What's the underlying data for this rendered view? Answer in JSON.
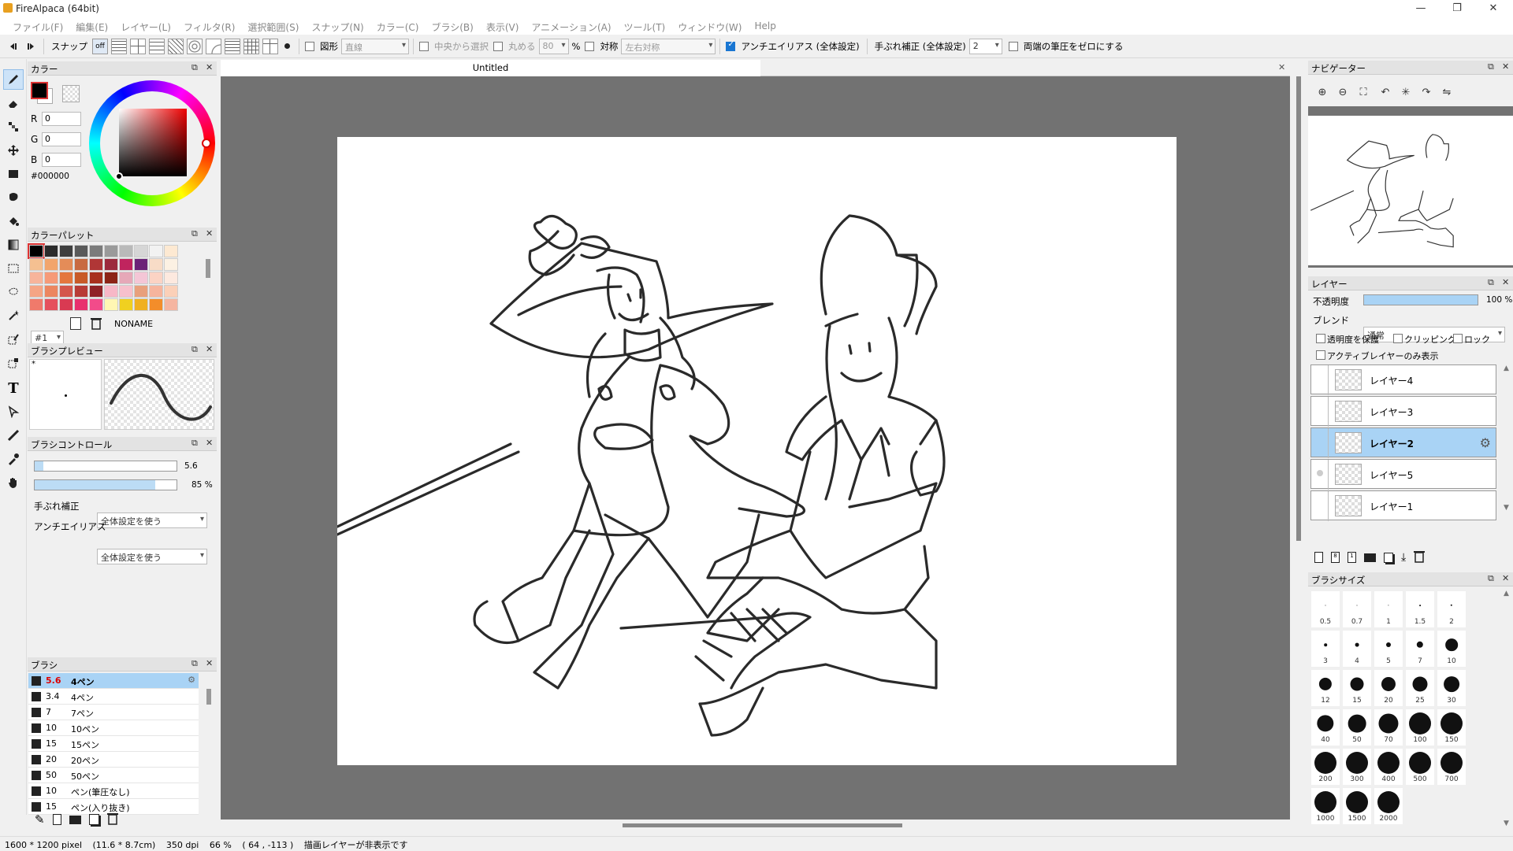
{
  "window": {
    "title": "FireAlpaca (64bit)",
    "controls": [
      "—",
      "❐",
      "✕"
    ]
  },
  "menu": [
    "ファイル(F)",
    "編集(E)",
    "レイヤー(L)",
    "フィルタ(R)",
    "選択範囲(S)",
    "スナップ(N)",
    "カラー(C)",
    "ブラシ(B)",
    "表示(V)",
    "アニメーション(A)",
    "ツール(T)",
    "ウィンドウ(W)",
    "Help"
  ],
  "toolbar": {
    "snap_label": "スナップ",
    "snap_off": "off",
    "shape_label": "図形",
    "shape_value": "直線",
    "center_label": "中央から選択",
    "round_label": "丸める",
    "round_value": "80",
    "percent": "%",
    "symmetry_label": "対称",
    "symmetry_value": "左右対称",
    "antialias_label": "アンチエイリアス (全体設定)",
    "stabilizer_label": "手ぶれ補正 (全体設定)",
    "stabilizer_value": "2",
    "zero_pressure_label": "両端の筆圧をゼロにする"
  },
  "color_panel": {
    "title": "カラー",
    "r_label": "R",
    "r": "0",
    "g_label": "G",
    "g": "0",
    "b_label": "B",
    "b": "0",
    "hex": "#000000",
    "fg_color": "#000000"
  },
  "palette_panel": {
    "title": "カラーパレット",
    "index": "#1",
    "name": "NONAME",
    "colors": [
      "#000000",
      "#2b2b2b",
      "#3f3f3f",
      "#5a5a5a",
      "#7b7b7b",
      "#9a9a9a",
      "#b9b9b9",
      "#d6d6d6",
      "#f2f2f2",
      "#fde9d2",
      "#f5c091",
      "#f2a56b",
      "#e48c58",
      "#c86a41",
      "#b03636",
      "#9c2a3d",
      "#c0245e",
      "#6b2277",
      "#f8dcc7",
      "#fcf1e3",
      "#f7b49b",
      "#f69a78",
      "#e4773e",
      "#c85a28",
      "#a8301d",
      "#8c2416",
      "#e6a8b8",
      "#f4c6d6",
      "#fbd3c4",
      "#fde9df",
      "#f5a585",
      "#ec8660",
      "#d4564b",
      "#b83b36",
      "#8f2226",
      "#f7b8c7",
      "#f7c0cc",
      "#e8a07c",
      "#f6b49d",
      "#fbd0b8",
      "#f07a6b",
      "#e5505d",
      "#d93a52",
      "#e8306e",
      "#f24b8a",
      "#fff7b3",
      "#f0d020",
      "#f0b020",
      "#f38d2a",
      "#f5b5a0"
    ]
  },
  "brush_preview": {
    "title": "ブラシプレビュー",
    "asterisk": "*"
  },
  "brush_control": {
    "title": "ブラシコントロール",
    "size": "5.6",
    "size_fraction": 0.06,
    "opacity": "85 %",
    "opacity_fraction": 0.85,
    "stabilizer_label": "手ぶれ補正",
    "stabilizer_value": "全体設定を使う",
    "antialias_label": "アンチエイリアス",
    "antialias_value": "全体設定を使う"
  },
  "brush_panel": {
    "title": "ブラシ",
    "items": [
      {
        "size": "5.6",
        "name": "4ペン"
      },
      {
        "size": "3.4",
        "name": "4ペン"
      },
      {
        "size": "7",
        "name": "7ペン"
      },
      {
        "size": "10",
        "name": "10ペン"
      },
      {
        "size": "15",
        "name": "15ペン"
      },
      {
        "size": "20",
        "name": "20ペン"
      },
      {
        "size": "50",
        "name": "50ペン"
      },
      {
        "size": "10",
        "name": "ペン(筆圧なし)"
      },
      {
        "size": "15",
        "name": "ペン(入り抜き)"
      }
    ]
  },
  "canvas": {
    "tab": "Untitled"
  },
  "navigator": {
    "title": "ナビゲーター"
  },
  "layers_panel": {
    "title": "レイヤー",
    "opacity_label": "不透明度",
    "opacity_value": "100 %",
    "opacity_fraction": 1.0,
    "blend_label": "ブレンド",
    "blend_value": "通常",
    "preserve_alpha": "透明度を保護",
    "clipping": "クリッピング",
    "lock": "ロック",
    "active_only": "アクティブレイヤーのみ表示",
    "layers": [
      {
        "name": "レイヤー4",
        "selected": false
      },
      {
        "name": "レイヤー3",
        "selected": false
      },
      {
        "name": "レイヤー2",
        "selected": true
      },
      {
        "name": "レイヤー5",
        "selected": false
      },
      {
        "name": "レイヤー1",
        "selected": false
      }
    ]
  },
  "brush_size_panel": {
    "title": "ブラシサイズ",
    "sizes": [
      "0.5",
      "0.7",
      "1",
      "1.5",
      "2",
      "3",
      "4",
      "5",
      "7",
      "10",
      "12",
      "15",
      "20",
      "25",
      "30",
      "40",
      "50",
      "70",
      "100",
      "150",
      "200",
      "300",
      "400",
      "500",
      "700",
      "1000",
      "1500",
      "2000"
    ]
  },
  "status": {
    "size": "1600 * 1200 pixel",
    "cm": "(11.6 * 8.7cm)",
    "dpi": "350 dpi",
    "zoom": "66 %",
    "coords": "( 64 , -113 )",
    "message": "描画レイヤーが非表示です"
  }
}
